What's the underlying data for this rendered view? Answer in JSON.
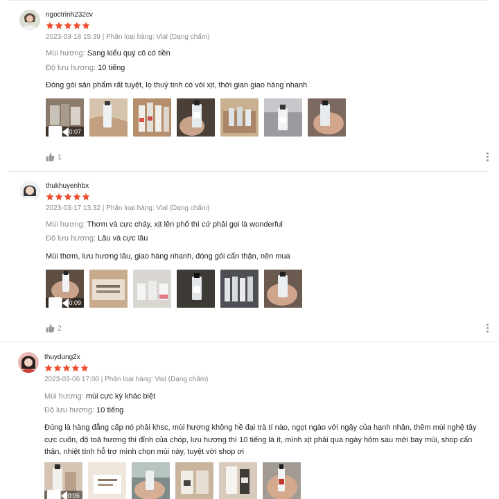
{
  "reviews": [
    {
      "username": "ngoctrinh232cv",
      "rating": 5,
      "date": "2023-03-18 15:39",
      "variation_label": "Phân loại hàng:",
      "variation": "Vial (Dạng chấm)",
      "scent_label": "Mùi hương:",
      "scent": "Sang kiểu quý cô có tiền",
      "longevity_label": "Độ lưu hương:",
      "longevity": "10 tiếng",
      "comment": "Đóng gói sản phẩm rất tuyệt, lọ thuỷ tinh có vòi xịt, thời gian giao hàng nhanh",
      "video_duration": "0:07",
      "likes": "1"
    },
    {
      "username": "thukhuyenhbx",
      "rating": 5,
      "date": "2023-03-17 13:32",
      "variation_label": "Phân loại hàng:",
      "variation": "Vial (Dạng chấm)",
      "scent_label": "Mùi hương:",
      "scent": "Thơm và cực cháy, xịt lên phố thì cứ phải gọi là wonderful",
      "longevity_label": "Độ lưu hương:",
      "longevity": "Lâu và cực lâu",
      "comment": "Mùi thơm, lưu hương lâu, giao hàng nhanh, đóng gói cẩn thận, nên mua",
      "video_duration": "0:09",
      "likes": "2"
    },
    {
      "username": "thuydung2x",
      "rating": 5,
      "date": "2023-03-06 17:00",
      "variation_label": "Phân loại hàng:",
      "variation": "Vial (Dạng chấm)",
      "scent_label": "Mùi hương:",
      "scent": "mùi cực kỳ khác biệt",
      "longevity_label": "Độ lưu hương:",
      "longevity": "10 tiếng",
      "comment": "Đúng là hàng đẳng cấp nó phải khsc, mùi hương không hề đại trà tí nào, ngọt ngào với ngậy của hạnh nhân, thêm mùi nghệ tây cực cuốn, độ toả hương thì đỉnh của chóp, lưu hương thì 10 tiếng là ít, mình xịt phải qua ngày hôm sau mới bay mùi, shop cẩn thận, nhiệt tình hỗ trợ mình chọn mùi này, tuyệt vời shop ơi",
      "video_duration": "0:06"
    }
  ],
  "colors": {
    "star": "#ee4d2d",
    "muted": "#8a8a8a",
    "divider": "#e8e8e8"
  },
  "icons": [
    "star-icon",
    "thumbs-up-icon",
    "video-camera-icon",
    "more-vertical-icon"
  ]
}
